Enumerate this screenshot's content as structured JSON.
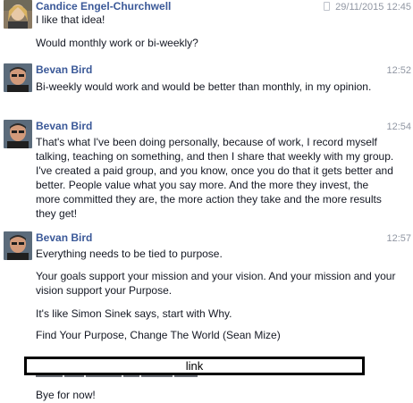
{
  "messages": [
    {
      "sender": "Candice Engel-Churchwell",
      "time": "29/11/2015 12:45",
      "paragraphs": [
        "I like that idea!",
        "Would monthly work or bi-weekly?"
      ]
    },
    {
      "sender": "Bevan Bird",
      "time": "12:52",
      "paragraphs": [
        "Bi-weekly would work and would be better than monthly, in my opinion."
      ]
    },
    {
      "sender": "Bevan Bird",
      "time": "12:54",
      "paragraphs": [
        "That's what I've been doing personally, because of work, I record myself talking, teaching on something, and then I share that weekly with my group. I've created a paid group, and you know, once you do that it gets better and better. People value what you say more. And the more they invest, the more committed they are, the more action they take and the more results they get!"
      ]
    },
    {
      "sender": "Bevan Bird",
      "time": "12:57",
      "paragraphs": [
        "Everything needs to be tied to purpose.",
        "Your goals support your mission and your vision. And your mission and your vision support your Purpose.",
        "It's like Simon Sinek says, start with Why.",
        "Find Your Purpose, Change The World (Sean Mize)"
      ]
    }
  ],
  "redaction": {
    "label": "link"
  },
  "closing": "Bye for now!",
  "colors": {
    "name": "#3b5998",
    "text": "#141823",
    "time": "#9197a3"
  },
  "icons": {
    "time_prefix": "mobile-phone-icon"
  }
}
